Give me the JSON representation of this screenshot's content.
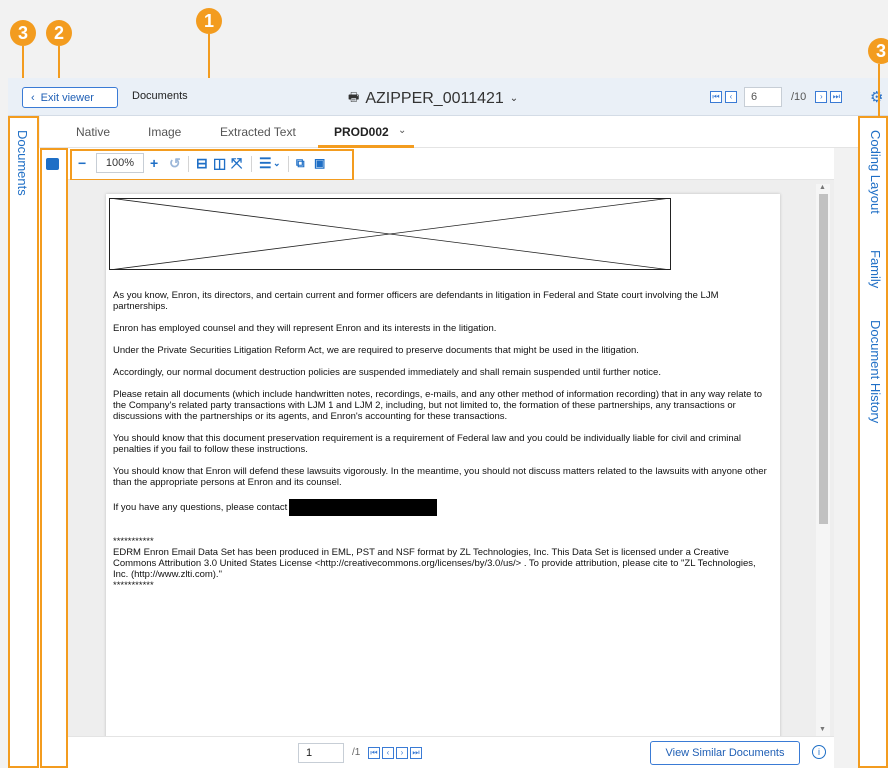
{
  "callouts": {
    "one": "1",
    "two": "2",
    "three": "3"
  },
  "header": {
    "exit_label": "Exit viewer",
    "documents_label": "Documents",
    "doc_title": "AZIPPER_0011421",
    "page_value": "6",
    "page_total": "/10"
  },
  "left_rail": {
    "label": "Documents"
  },
  "tabs": [
    {
      "label": "Native"
    },
    {
      "label": "Image"
    },
    {
      "label": "Extracted Text"
    },
    {
      "label": "PROD002"
    }
  ],
  "toolbar": {
    "zoom": "100%"
  },
  "document": {
    "paragraphs": [
      "As you know, Enron, its directors, and certain current and former officers are defendants in litigation in Federal and State court involving the LJM partnerships.",
      "Enron has employed counsel and they will represent Enron and its interests in the litigation.",
      "Under the Private Securities Litigation Reform Act, we are required to preserve documents that might be used in the litigation.",
      "Accordingly, our normal document destruction policies are suspended immediately and shall remain suspended until further notice.",
      "Please retain all documents (which include handwritten notes, recordings, e-mails, and any other method of information recording) that in any way relate to the Company's related party transactions with LJM 1 and LJM 2, including, but not limited to, the formation of these partnerships, any transactions or discussions with the partnerships or its agents, and Enron's accounting for these transactions.",
      "You should know that this document preservation requirement is a requirement of Federal law and you could be individually liable for civil and criminal penalties if you fail to follow these instructions.",
      "You should know that Enron will defend these lawsuits vigorously.  In the meantime, you should not discuss matters related to the lawsuits with anyone other than the appropriate persons at Enron and its counsel."
    ],
    "contact_line": "If you have any questions, please contact",
    "stars": "***********",
    "footnote": "EDRM Enron Email Data Set has been produced in EML, PST and NSF format by ZL Technologies, Inc. This Data Set is licensed under a Creative Commons Attribution 3.0 United States License <http://creativecommons.org/licenses/by/3.0/us/> . To provide attribution, please cite to \"ZL Technologies, Inc. (http://www.zlti.com).\""
  },
  "bottom": {
    "page_value": "1",
    "page_total": "/1",
    "similar_label": "View Similar Documents"
  },
  "right_rail": {
    "items": [
      {
        "label": "Coding Layout"
      },
      {
        "label": "Family"
      },
      {
        "label": "Document History"
      }
    ]
  },
  "colors": {
    "accent": "#f39c1f",
    "link": "#1f6fc6"
  }
}
